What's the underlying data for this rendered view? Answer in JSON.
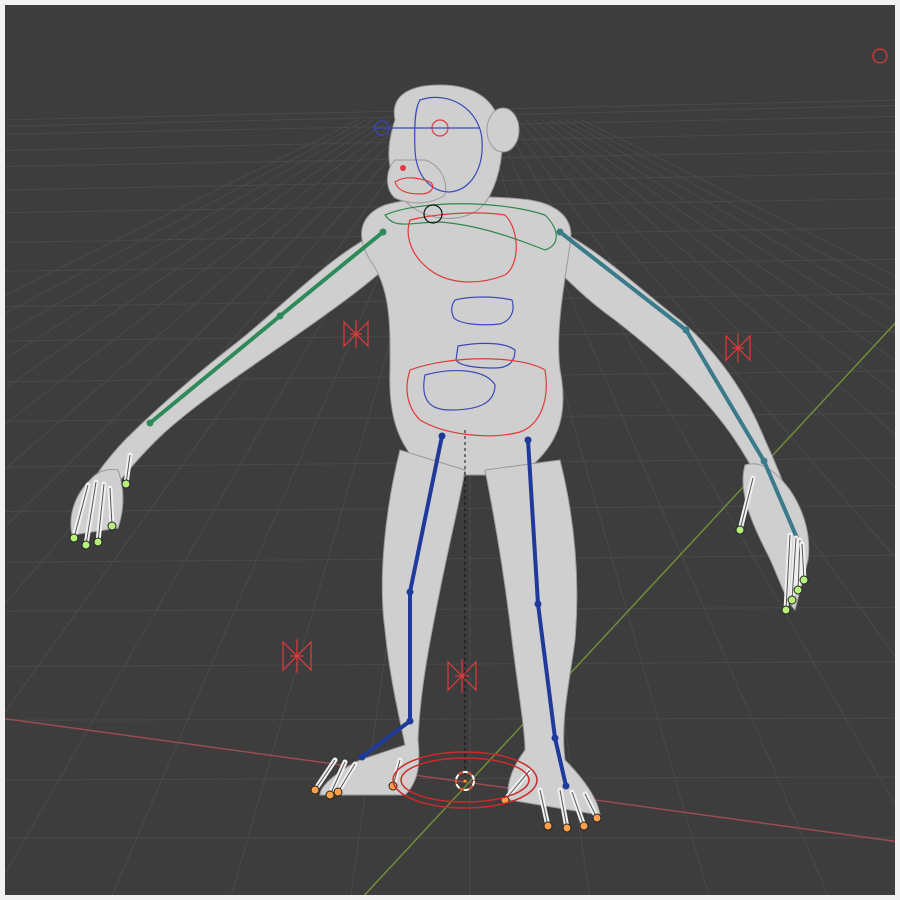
{
  "app": {
    "name": "3D viewport",
    "view": "perspective",
    "mode": "pose"
  },
  "scene": {
    "background": "#3d3d3d",
    "grid_color": "#4a4a4a",
    "x_axis_color": "#9b4b53",
    "y_axis_color": "#6f8c3a",
    "mesh_color": "#cfcfcf",
    "objects": [
      {
        "name": "mesh-body",
        "type": "mesh",
        "shape": "primate"
      },
      {
        "name": "armature",
        "type": "armature"
      }
    ]
  },
  "bones": {
    "left_arm_color": "#2f8a5a",
    "right_arm_color": "#3a7a8a",
    "leg_color": "#1f3a9a",
    "joint_tip_color": "#b6f07a",
    "foot_tip_color": "#ffa04a"
  },
  "controls": {
    "fk_color": "#e03a3a",
    "torso_color": "#3a4ab8",
    "neck_color": "#2f8a4a",
    "root_color": "#cc2a2a",
    "widget_icons": [
      "ik-target-icon",
      "root-control-icon",
      "pole-target-icon"
    ]
  },
  "3d_cursor": {
    "color_a": "#ffffff",
    "color_b": "#e05a3a"
  }
}
